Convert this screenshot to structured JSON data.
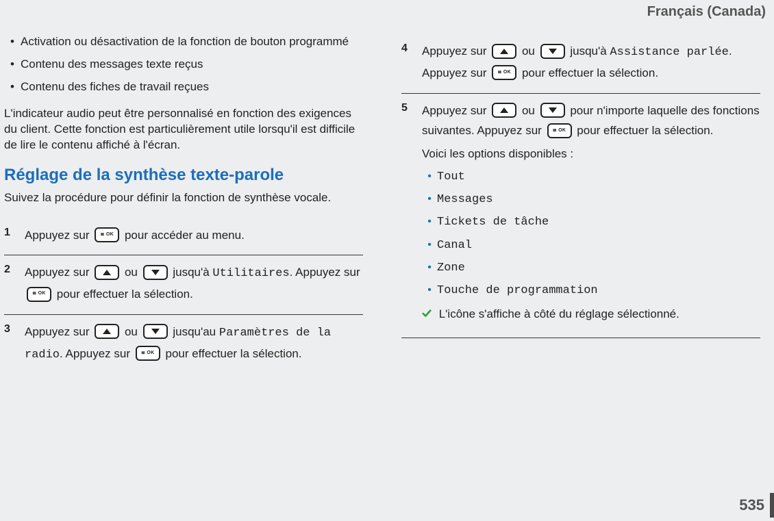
{
  "header": {
    "language": "Français (Canada)"
  },
  "footer": {
    "page": "535"
  },
  "left": {
    "bullets": [
      "Activation ou désactivation de la fonction de bouton programmé",
      "Contenu des messages texte reçus",
      "Contenu des fiches de travail reçues"
    ],
    "paragraph": "L'indicateur audio peut être personnalisé en fonction des exigences du client. Cette fonction est particulièrement utile lorsqu'il est difficile de lire le contenu affiché à l'écran.",
    "heading": "Réglage de la synthèse texte-parole",
    "subparagraph": "Suivez la procédure pour définir la fonction de synthèse vocale.",
    "steps": {
      "s1": {
        "num": "1",
        "t1": "Appuyez sur ",
        "t2": " pour accéder au menu."
      },
      "s2": {
        "num": "2",
        "t1": "Appuyez sur ",
        "t2": " ou ",
        "t3": " jusqu'à ",
        "code": "Utilitaires",
        "t4": ". Appuyez sur ",
        "t5": " pour effectuer la sélection."
      },
      "s3": {
        "num": "3",
        "t1": "Appuyez sur ",
        "t2": " ou ",
        "t3": " jusqu'au ",
        "code": "Paramètres de la radio",
        "t4": ". Appuyez sur ",
        "t5": " pour effectuer la sélection."
      }
    }
  },
  "right": {
    "steps": {
      "s4": {
        "num": "4",
        "t1": "Appuyez sur ",
        "t2": " ou ",
        "t3": " jusqu'à ",
        "code": "Assistance parlée",
        "t4": ". Appuyez sur ",
        "t5": " pour effectuer la sélection."
      },
      "s5": {
        "num": "5",
        "t1": "Appuyez sur ",
        "t2": " ou ",
        "t3": " pour n'importe laquelle des fonctions suivantes. Appuyez sur ",
        "t4": " pour effectuer la sélection.",
        "optsIntro": "Voici les options disponibles :",
        "options": [
          "Tout",
          "Messages",
          "Tickets de tâche",
          "Canal",
          "Zone",
          "Touche de programmation"
        ],
        "note": " L'icône s'affiche à côté du réglage sélectionné."
      }
    }
  }
}
